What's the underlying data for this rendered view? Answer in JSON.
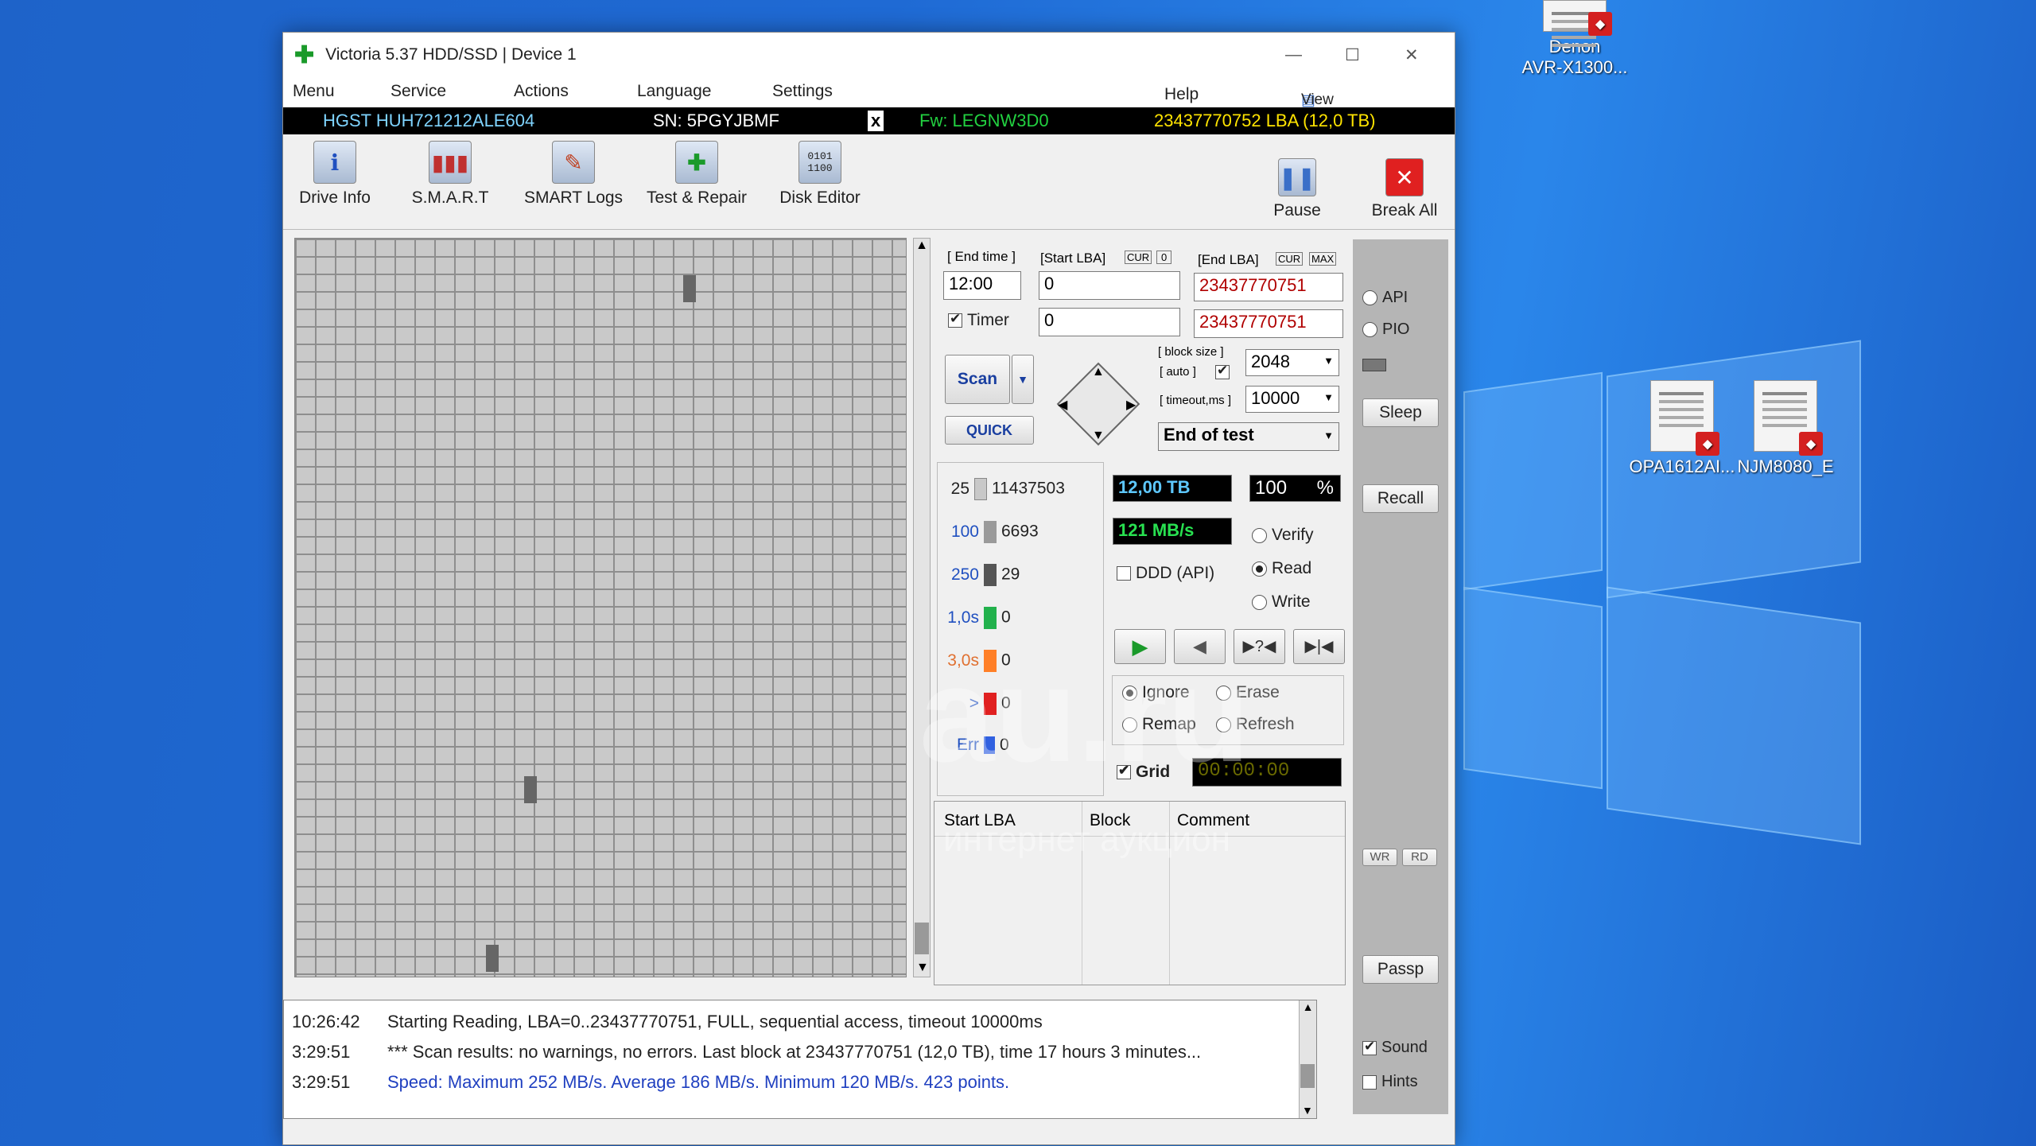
{
  "desktop": {
    "icons": [
      {
        "label1": "Denon",
        "label2": "AVR-X1300..."
      },
      {
        "label": "OPA1612AI..."
      },
      {
        "label": "NJM8080_E"
      }
    ]
  },
  "window": {
    "title": "Victoria 5.37 HDD/SSD | Device 1",
    "min": "—",
    "max": "☐",
    "close": "✕"
  },
  "menu": {
    "items": [
      "Menu",
      "Service",
      "Actions",
      "Language",
      "Settings"
    ],
    "help": "Help",
    "view_buffer": "View Buffer Live"
  },
  "drive": {
    "model": "HGST HUH721212ALE604",
    "serial": "SN: 5PGYJBMF",
    "x": "x",
    "firmware": "Fw: LEGNW3D0",
    "lba": "23437770752 LBA (12,0 TB)"
  },
  "toolbar": {
    "drive_info": "Drive Info",
    "smart": "S.M.A.R.T",
    "smart_logs": "SMART Logs",
    "test_repair": "Test & Repair",
    "disk_editor": "Disk Editor",
    "pause": "Pause",
    "break_all": "Break All"
  },
  "test": {
    "end_time_label": "[ End time ]",
    "end_time": "12:00",
    "timer_label": "Timer",
    "start_lba_label": "[Start LBA]",
    "cur": "CUR",
    "zero": "0",
    "start_lba": "0",
    "start_lba2": "0",
    "end_lba_label": "[End LBA]",
    "max": "MAX",
    "end_lba": "23437770751",
    "end_lba2": "23437770751",
    "scan": "Scan",
    "quick": "QUICK",
    "block_size_label": "[ block size ]",
    "auto_label": "[ auto ]",
    "block_size": "2048",
    "timeout_label": "[ timeout,ms ]",
    "timeout": "10000",
    "end_action": "End of test",
    "size": "12,00 TB",
    "percent": "100",
    "pct_sign": "%",
    "speed": "121 MB/s",
    "verify": "Verify",
    "read": "Read",
    "write": "Write",
    "ddd": "DDD (API)",
    "ignore": "Ignore",
    "erase": "Erase",
    "remap": "Remap",
    "refresh": "Refresh",
    "grid": "Grid",
    "clock": "00:00:00"
  },
  "histogram": [
    {
      "label": "25",
      "count": "11437503",
      "color": "#c8c8c8"
    },
    {
      "label": "100",
      "count": "6693",
      "color": "#9a9a9a"
    },
    {
      "label": "250",
      "count": "29",
      "color": "#6a6a6a"
    },
    {
      "label": "1,0s",
      "count": "0",
      "color": "#22b14c"
    },
    {
      "label": "3,0s",
      "count": "0",
      "color": "#ff7f27"
    },
    {
      "label": ">",
      "count": "0",
      "color": "#e02020"
    },
    {
      "label": "Err",
      "count": "0",
      "color": "#3060e0"
    }
  ],
  "errtable": {
    "cols": [
      "Start LBA",
      "Block",
      "Comment"
    ]
  },
  "side": {
    "api": "API",
    "pio": "PIO",
    "sleep": "Sleep",
    "recall": "Recall",
    "wr": "WR",
    "rd": "RD",
    "passp": "Passp",
    "sound": "Sound",
    "hints": "Hints"
  },
  "log": [
    {
      "time": "10:26:42",
      "msg": "Starting Reading, LBA=0..23437770751, FULL, sequential access, timeout 10000ms"
    },
    {
      "time": "3:29:51",
      "msg": "*** Scan results: no warnings, no errors. Last block at 23437770751 (12,0 TB), time 17 hours 3 minutes..."
    },
    {
      "time": "3:29:51",
      "msg": "Speed: Maximum 252 MB/s. Average 186 MB/s. Minimum 120 MB/s. 423 points."
    }
  ],
  "watermark": "au.ru",
  "watermark2": "интернет аукцион"
}
